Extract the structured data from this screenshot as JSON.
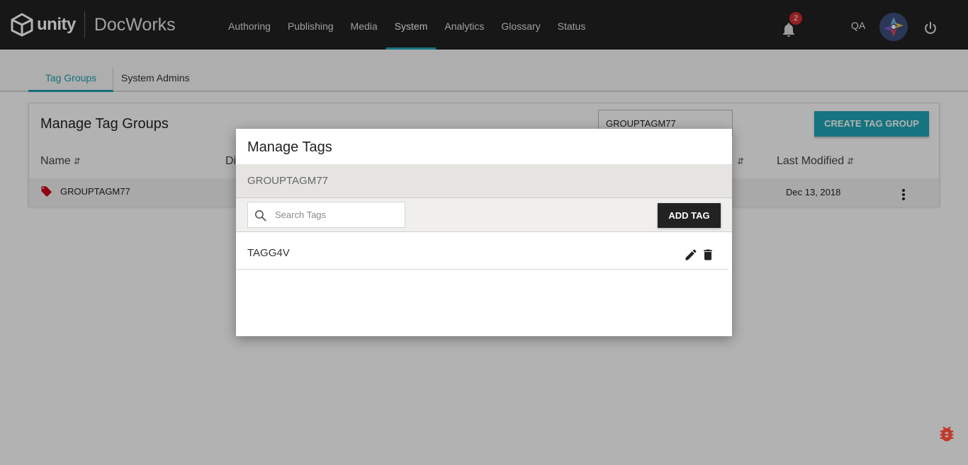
{
  "app": {
    "brand": "unity",
    "name": "DocWorks"
  },
  "nav": {
    "items": [
      "Authoring",
      "Publishing",
      "Media",
      "System",
      "Analytics",
      "Glossary",
      "Status"
    ],
    "active": "System"
  },
  "header": {
    "notification_count": "2",
    "user_initials": "QA"
  },
  "subtabs": {
    "items": [
      "Tag Groups",
      "System Admins"
    ],
    "active": "Tag Groups"
  },
  "card": {
    "title": "Manage Tag Groups",
    "filter_value": "GROUPTAGM77",
    "create_button": "CREATE TAG GROUP",
    "columns": [
      "Name",
      "Di",
      "Last Modified"
    ],
    "rows": [
      {
        "name": "GROUPTAGM77",
        "last_modified": "Dec 13, 2018"
      }
    ]
  },
  "modal": {
    "title": "Manage Tags",
    "group_name": "GROUPTAGM77",
    "search_placeholder": "Search Tags",
    "add_button": "ADD TAG",
    "tags": [
      "TAGG4V"
    ]
  },
  "colors": {
    "accent": "#1fa6b7",
    "topbar": "#222222",
    "badge": "#d32f2f",
    "tag_icon": "#d0021b",
    "bug_icon": "#c0392b"
  }
}
